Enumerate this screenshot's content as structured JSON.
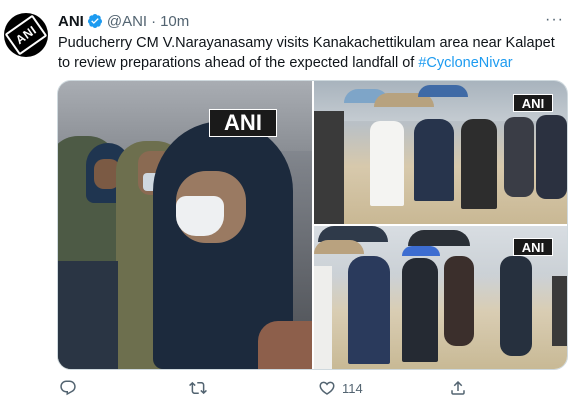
{
  "tweet": {
    "author_name": "ANI",
    "handle": "@ANI",
    "separator": "·",
    "time": "10m",
    "more_label": "···",
    "text_main": "Puducherry CM V.Narayanasamy visits Kanakachettikulam area near Kalapet to review preparations ahead of the expected landfall of ",
    "hashtag": "#CycloneNivar",
    "avatar_text": "ANI"
  },
  "media": {
    "watermark": "ANI"
  },
  "actions": {
    "reply_count": "",
    "retweet_count": "",
    "like_count": "114",
    "share_count": ""
  },
  "icons": {
    "verified": "verified-badge-icon",
    "reply": "reply-icon",
    "retweet": "retweet-icon",
    "like": "heart-icon",
    "share": "share-icon"
  },
  "colors": {
    "accent": "#1d9bf0",
    "text": "#0f1419",
    "muted": "#536471"
  }
}
